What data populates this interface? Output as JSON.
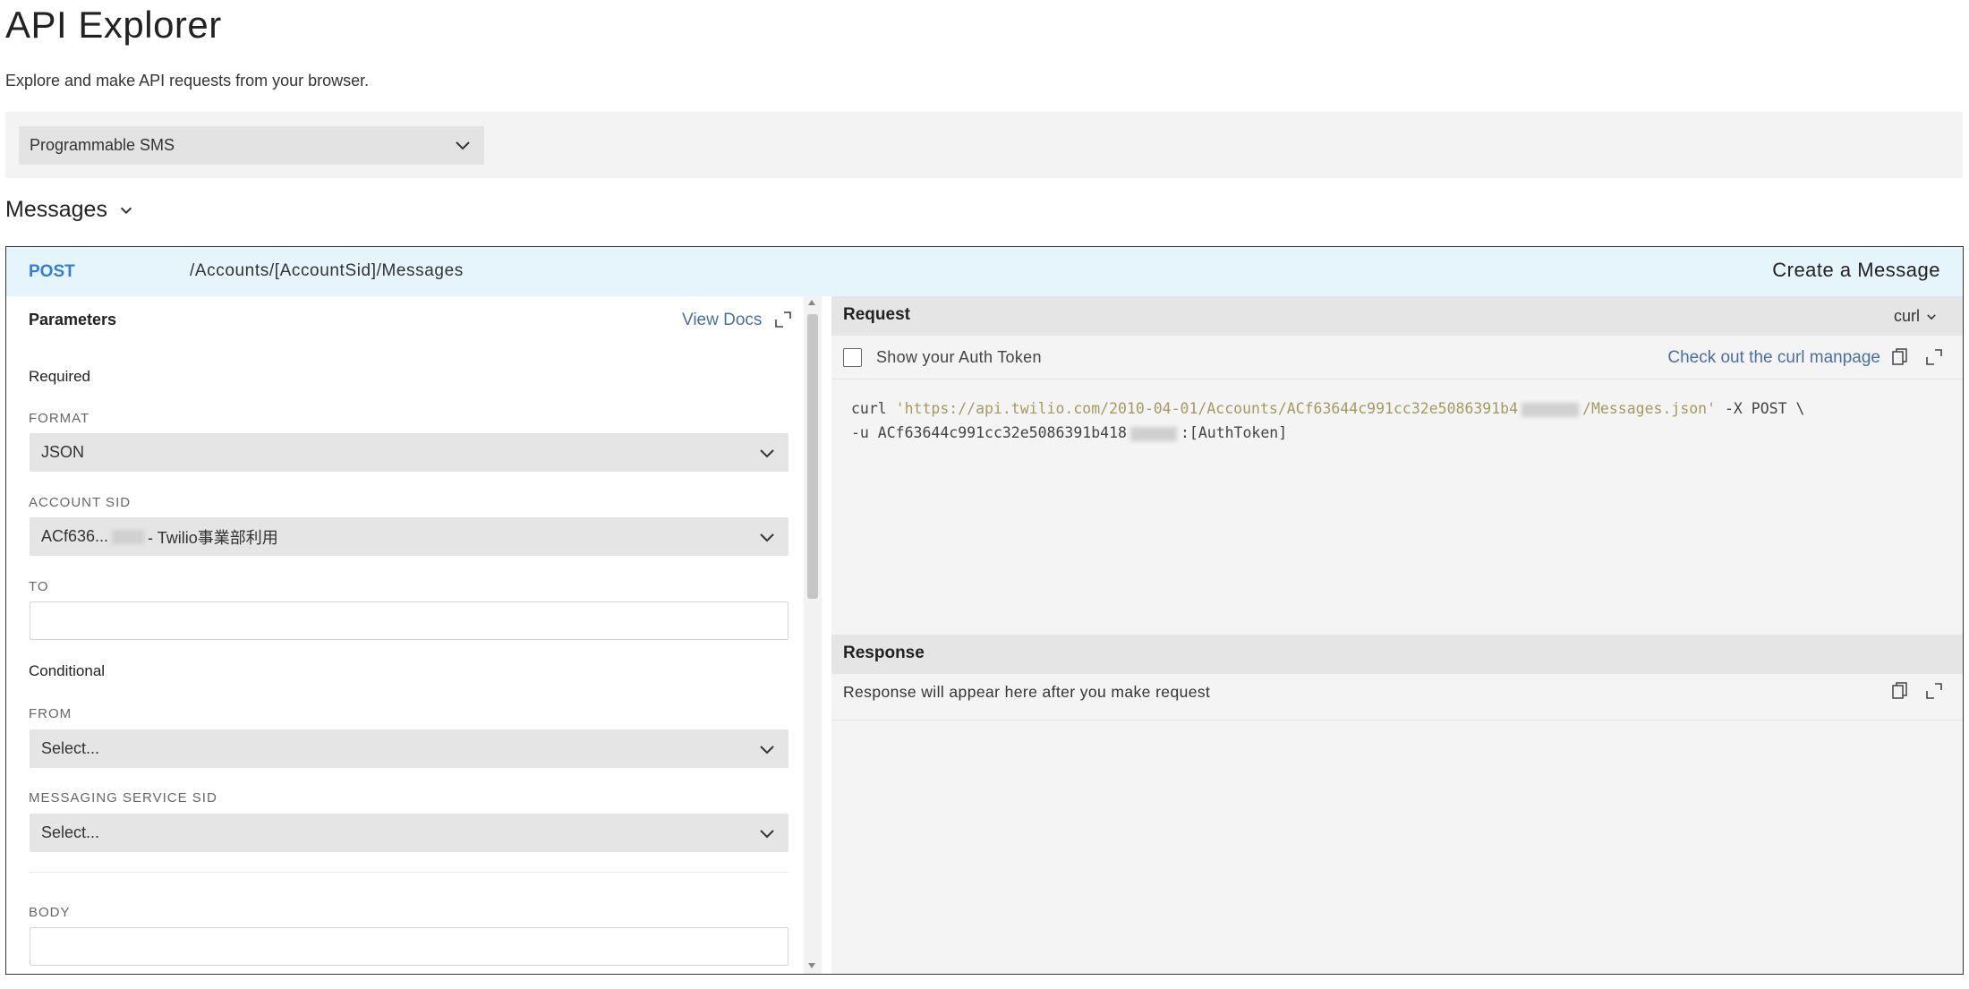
{
  "page": {
    "title": "API Explorer",
    "subtitle": "Explore and make API requests from your browser."
  },
  "product_selector": {
    "value": "Programmable SMS",
    "icon": "chevron-down-icon"
  },
  "section": {
    "label": "Messages",
    "icon": "chevron-down-icon"
  },
  "endpoint": {
    "method": "POST",
    "path": "/Accounts/[AccountSid]/Messages",
    "operation": "Create a Message",
    "method_color": "#2f7fdb",
    "bar_color": "#e6f4fc"
  },
  "parameters": {
    "heading": "Parameters",
    "view_docs": "View Docs",
    "required_heading": "Required",
    "conditional_heading": "Conditional",
    "format": {
      "label": "FORMAT",
      "value": "JSON"
    },
    "account_sid": {
      "label": "ACCOUNT SID",
      "value_prefix": "ACf636...",
      "value_suffix": "- Twilio事業部利用"
    },
    "to": {
      "label": "TO",
      "value": ""
    },
    "from": {
      "label": "FROM",
      "value": "Select..."
    },
    "messaging_service_sid": {
      "label": "MESSAGING SERVICE SID",
      "value": "Select..."
    },
    "body": {
      "label": "BODY",
      "value": ""
    }
  },
  "request": {
    "heading": "Request",
    "language": "curl",
    "show_auth_label": "Show your Auth Token",
    "manpage_link": "Check out the curl manpage",
    "code_line1_cmd": "curl ",
    "code_line1_url_start": "'https://api.twilio.com/2010-04-01/Accounts/ACf63644c991cc32e5086391b4",
    "code_line1_url_end": "/Messages.json'",
    "code_line1_tail": " -X POST \\",
    "code_line2_start": "-u ACf63644c991cc32e5086391b418",
    "code_line2_end": ":[AuthToken]"
  },
  "response": {
    "heading": "Response",
    "placeholder": "Response will appear here after you make request"
  },
  "colors": {
    "link": "#4a6fa5",
    "code_string": "#a59a5f",
    "pane_header": "#e5e5e5"
  }
}
